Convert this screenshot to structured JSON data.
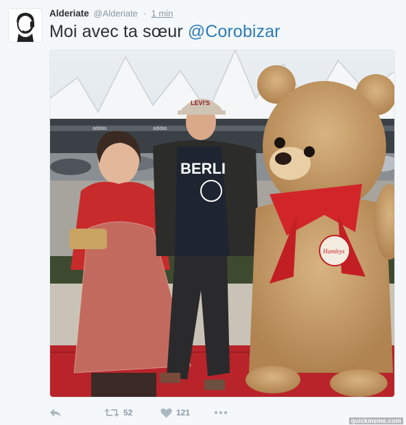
{
  "tweet": {
    "display_name": "Alderiate",
    "handle": "@Alderiate",
    "separator": "·",
    "timestamp": "1 min",
    "text_main": "Moi avec ta sœur ",
    "mention": "@Corobizar",
    "photo_sign_berlin": "BERLI",
    "photo_cap_text": "LEVI'S",
    "photo_bear_badge": "Hamleys",
    "photo_store_sign": "adidas"
  },
  "actions": {
    "reply_icon": "reply-icon",
    "retweet_icon": "retweet-icon",
    "retweet_count": "52",
    "like_icon": "heart-icon",
    "like_count": "121",
    "more_icon": "more-dots-icon"
  },
  "watermark": "quickmeme.com",
  "colors": {
    "mention": "#2b7bb9",
    "name": "#292f33",
    "muted": "#8899a6",
    "background": "#f5f8fa"
  }
}
